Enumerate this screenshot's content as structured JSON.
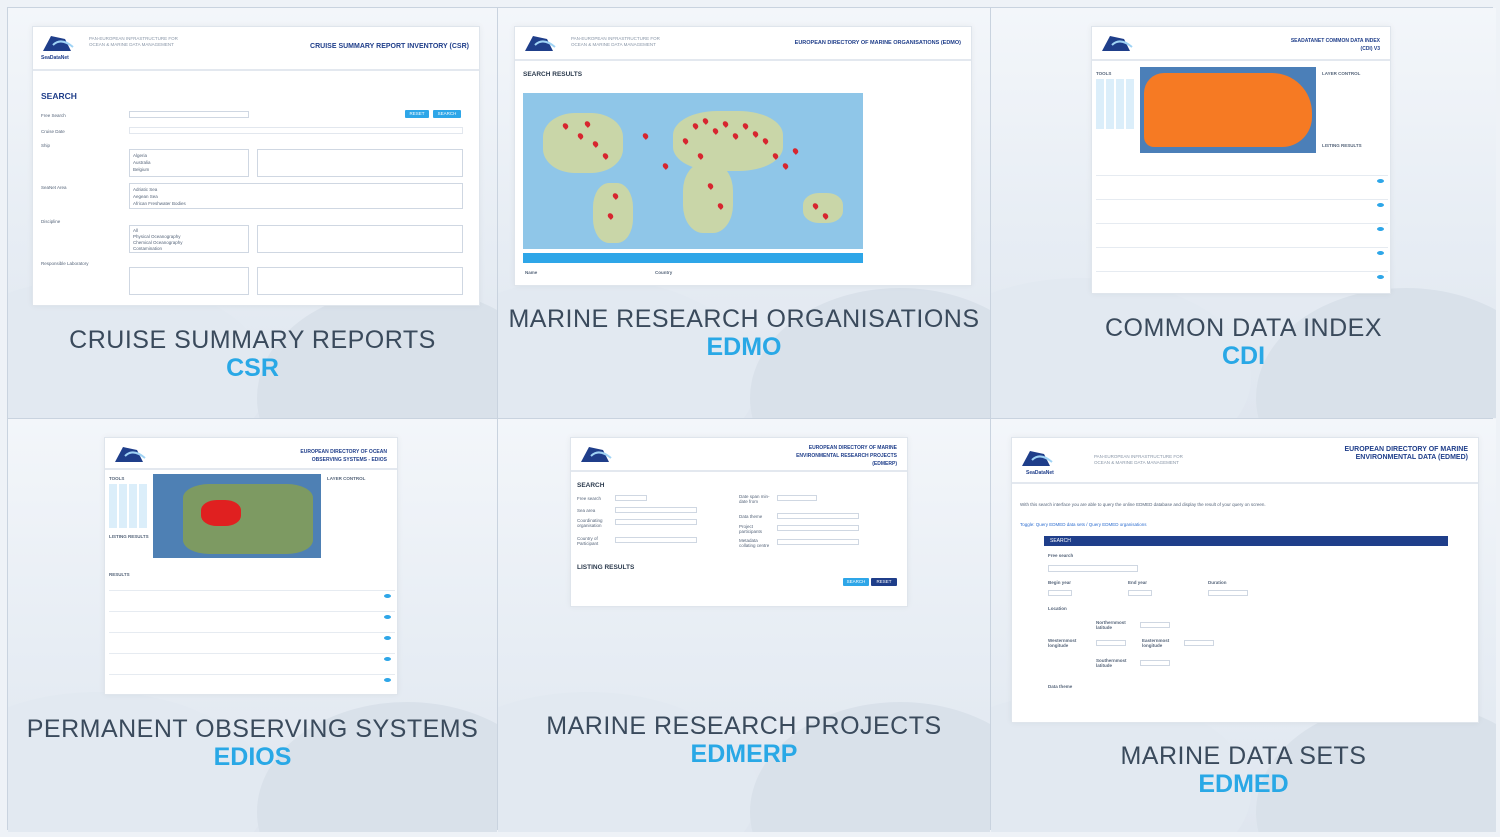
{
  "tiles": [
    {
      "title": "CRUISE SUMMARY REPORTS",
      "code": "CSR"
    },
    {
      "title": "MARINE RESEARCH ORGANISATIONS",
      "code": "EDMO"
    },
    {
      "title": "COMMON DATA INDEX",
      "code": "CDI"
    },
    {
      "title": "PERMANENT OBSERVING SYSTEMS",
      "code": "EDIOS"
    },
    {
      "title": "MARINE RESEARCH PROJECTS",
      "code": "EDMERP"
    },
    {
      "title": "MARINE DATA SETS",
      "code": "EDMED"
    }
  ],
  "shots": {
    "logo_text": "SeaDataNet",
    "subtitle": "PAN-EUROPEAN INFRASTRUCTURE FOR OCEAN & MARINE DATA MANAGEMENT",
    "csr": {
      "title": "CRUISE SUMMARY REPORT INVENTORY (CSR)",
      "search": "SEARCH",
      "free_search": "Free Search",
      "cruise_date": "Cruise Date",
      "ship": "Ship",
      "seabed_area": "SeaNet Area",
      "discipline": "Discipline",
      "lab": "Responsible Laboratory",
      "reset": "RESET",
      "search_btn": "SEARCH",
      "countries": [
        "Algeria",
        "Australia",
        "Belgium"
      ],
      "areas": [
        "Adriatic Sea",
        "Aegean Sea",
        "African Freshwater Bodies"
      ],
      "groups": [
        "All",
        "Physical Oceanography",
        "Chemical Oceanography",
        "Contamination"
      ]
    },
    "edmo": {
      "title": "EUROPEAN DIRECTORY OF MARINE ORGANISATIONS (EDMO)",
      "search_results": "SEARCH RESULTS",
      "name_col": "Name",
      "country_col": "Country"
    },
    "cdi": {
      "title": "SEADATANET COMMON DATA INDEX (CDI) V3",
      "tools": "TOOLS",
      "layer_control": "LAYER CONTROL",
      "listing": "LISTING RESULTS"
    },
    "edios": {
      "title": "EUROPEAN DIRECTORY OF OCEAN OBSERVING SYSTEMS - EDIOS",
      "tools": "TOOLS",
      "layer_control": "LAYER CONTROL",
      "listing": "LISTING RESULTS",
      "results": "RESULTS"
    },
    "edmerp": {
      "title": "EUROPEAN DIRECTORY OF MARINE ENVIRONMENTAL RESEARCH PROJECTS (EDMERP)",
      "search": "SEARCH",
      "listing": "LISTING RESULTS",
      "free_search": "Free search",
      "sea_area": "Sea area",
      "coord_org": "Coordinating organisation",
      "country": "Country of Participant",
      "date_span": "Date span min-date from",
      "data_theme": "Data theme",
      "project_part": "Project participants",
      "metadata_centre": "Metadata collating centre",
      "search_btn": "SEARCH",
      "reset_btn": "RESET"
    },
    "edmed": {
      "title": "EUROPEAN DIRECTORY OF MARINE ENVIRONMENTAL DATA (EDMED)",
      "intro": "With this search interface you are able to query the online EDMED database and display the result of your query on screen.",
      "toggle": "Toggle: Query EDMED data sets / Query EDMED organisations",
      "search": "SEARCH",
      "free_search": "Free search",
      "begin_year": "Begin year",
      "end_year": "End year",
      "duration": "Duration",
      "location": "Location",
      "north": "Northernmost latitude",
      "west": "Westernmost longitude",
      "east": "Easternmost longitude",
      "south": "Southernmost latitude",
      "data_theme": "Data theme"
    }
  },
  "colors": {
    "accent": "#29a8e6",
    "title": "#3a4a5c",
    "navy": "#1f3e8a",
    "pin": "#d7262f",
    "orange": "#ff7a1a"
  }
}
